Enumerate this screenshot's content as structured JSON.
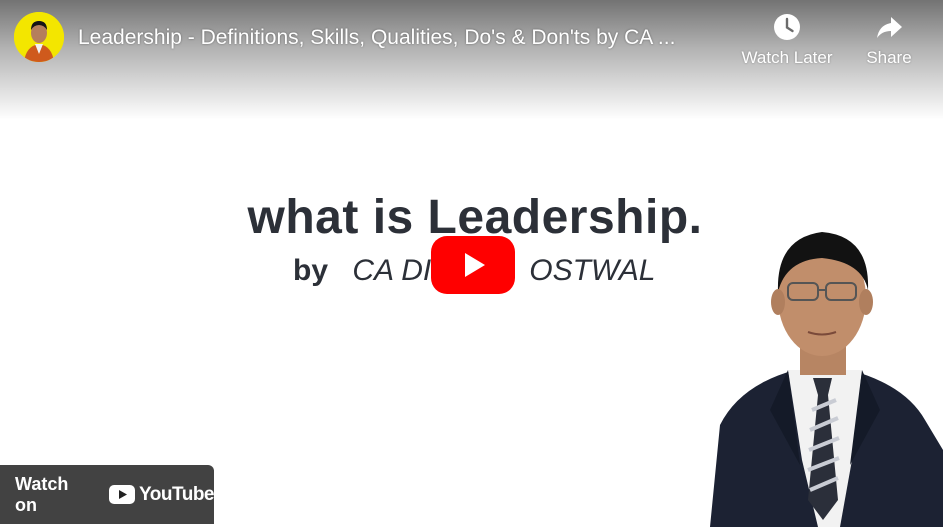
{
  "video": {
    "title": "Leadership - Definitions, Skills, Qualities, Do's & Don'ts by CA ..."
  },
  "top_actions": {
    "watch_later_label": "Watch Later",
    "watch_later_icon": "clock-icon",
    "share_label": "Share",
    "share_icon": "share-arrow-icon"
  },
  "slide": {
    "heading": "what is Leadership.",
    "byline_prefix": "by",
    "byline_name_visible": "CA DI",
    "byline_surname_visible": "OSTWAL"
  },
  "watch_on": {
    "label": "Watch on",
    "brand": "YouTube"
  },
  "colors": {
    "play_red": "#ff0000",
    "avatar_yellow": "#f3e600",
    "text_dark": "#2c3038",
    "overlay": "#212121"
  }
}
